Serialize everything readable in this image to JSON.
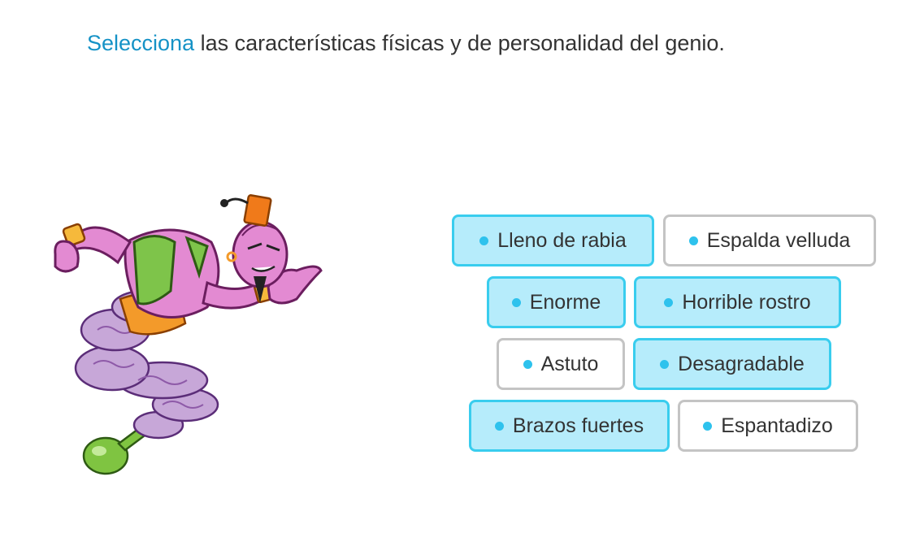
{
  "instruction": {
    "verb": "Selecciona",
    "rest": " las características físicas y de personalidad del genio."
  },
  "colors": {
    "accent_text": "#1592c6",
    "selected_fill": "#b6ecfb",
    "selected_border": "#39cdee",
    "unselected_border": "#c4c4c4",
    "bullet": "#2ec2ed"
  },
  "image": {
    "icon": "genie-illustration-icon"
  },
  "options": [
    {
      "label": "Lleno de rabia",
      "selected": true
    },
    {
      "label": "Espalda velluda",
      "selected": false
    },
    {
      "label": "Enorme",
      "selected": true
    },
    {
      "label": "Horrible rostro",
      "selected": true
    },
    {
      "label": "Astuto",
      "selected": false
    },
    {
      "label": "Desagradable",
      "selected": true
    },
    {
      "label": "Brazos fuertes",
      "selected": true
    },
    {
      "label": "Espantadizo",
      "selected": false
    }
  ]
}
